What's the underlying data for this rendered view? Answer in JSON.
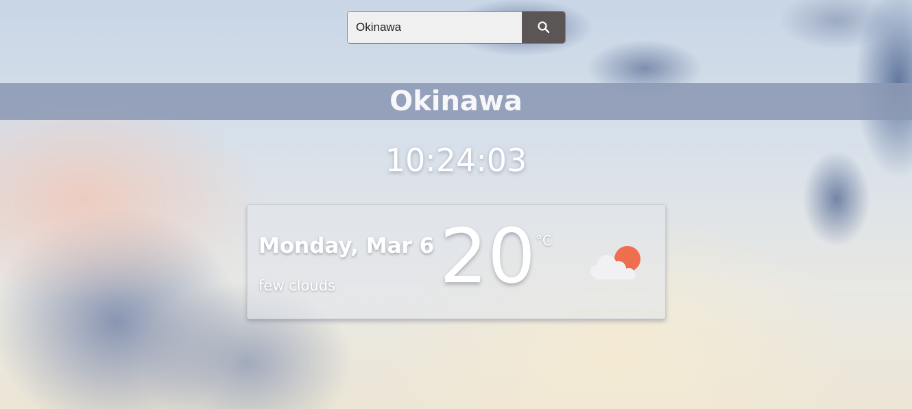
{
  "search": {
    "value": "Okinawa",
    "button_icon": "search-icon"
  },
  "location": {
    "city": "Okinawa"
  },
  "clock": {
    "time": "10:24:03"
  },
  "weather": {
    "date": "Monday, Mar 6",
    "description": "few clouds",
    "temperature": "20",
    "unit": "°C",
    "icon": "few-clouds-icon"
  },
  "colors": {
    "banner": "#8c98b4",
    "search_button": "#5c5555",
    "sun": "#ee6e4e",
    "cloud": "#f1f1f3"
  }
}
